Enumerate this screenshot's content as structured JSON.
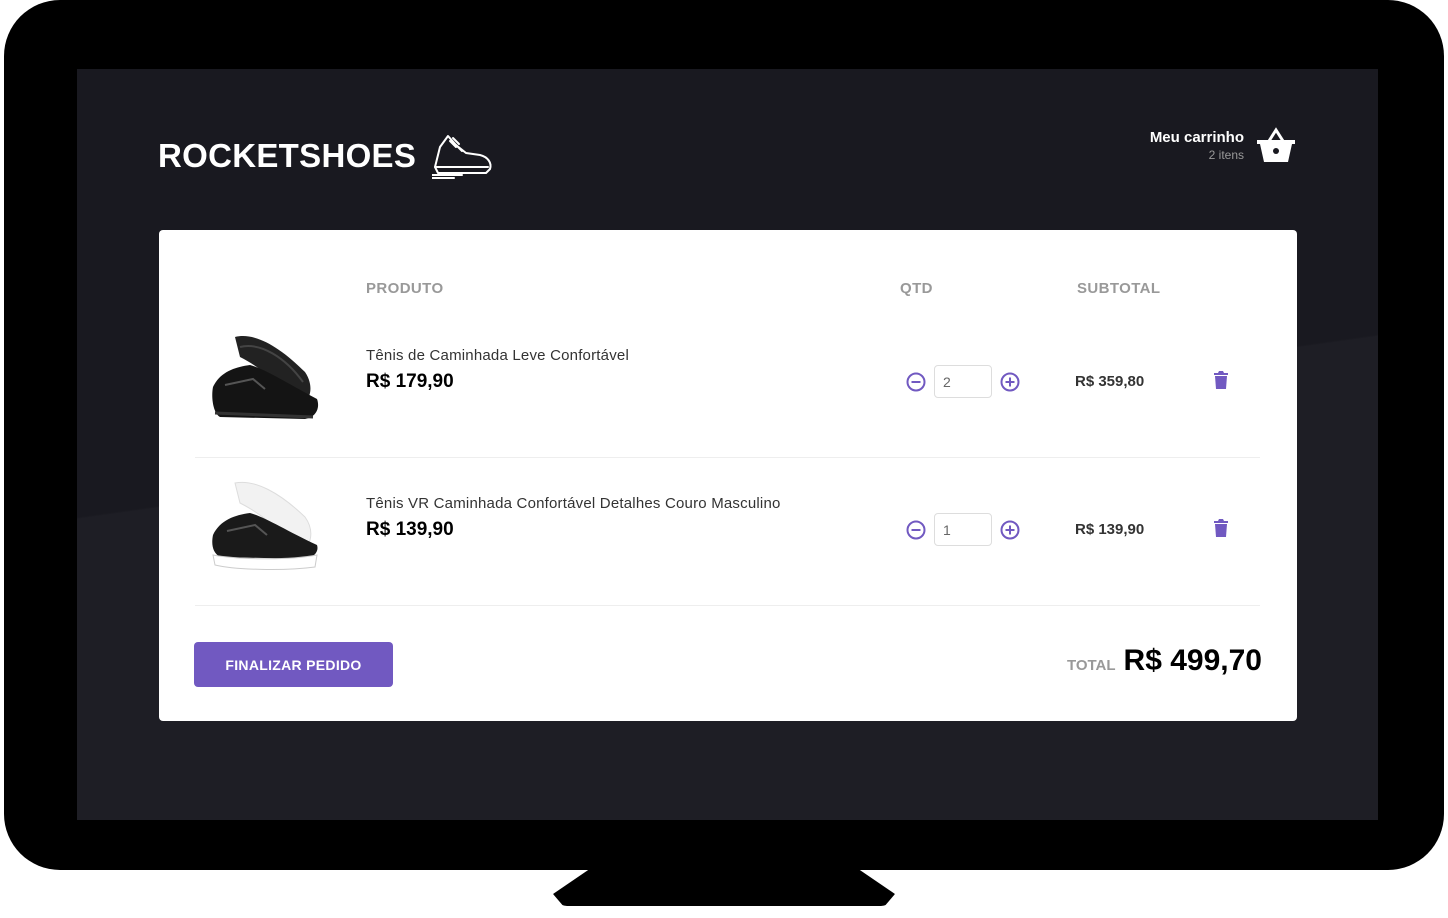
{
  "header": {
    "logo_text": "ROCKETSHOES",
    "logo_icon": "sneaker-icon",
    "cart_title": "Meu carrinho",
    "cart_count": "2 itens",
    "cart_icon": "basket-icon"
  },
  "table": {
    "headers": {
      "product": "PRODUTO",
      "qty": "QTD",
      "subtotal": "SUBTOTAL"
    },
    "items": [
      {
        "name": "Tênis de Caminhada Leve Confortável",
        "price": "R$ 179,90",
        "quantity": "2",
        "subtotal": "R$ 359,80",
        "image_icon": "black-sneaker-image"
      },
      {
        "name": "Tênis VR Caminhada Confortável Detalhes Couro Masculino",
        "price": "R$ 139,90",
        "quantity": "1",
        "subtotal": "R$ 139,90",
        "image_icon": "black-white-sneaker-image"
      }
    ]
  },
  "footer": {
    "finalize_label": "FINALIZAR PEDIDO",
    "total_label": "TOTAL",
    "total_value": "R$ 499,70"
  },
  "colors": {
    "accent": "#7159c1",
    "background": "#191920",
    "card": "#ffffff"
  }
}
